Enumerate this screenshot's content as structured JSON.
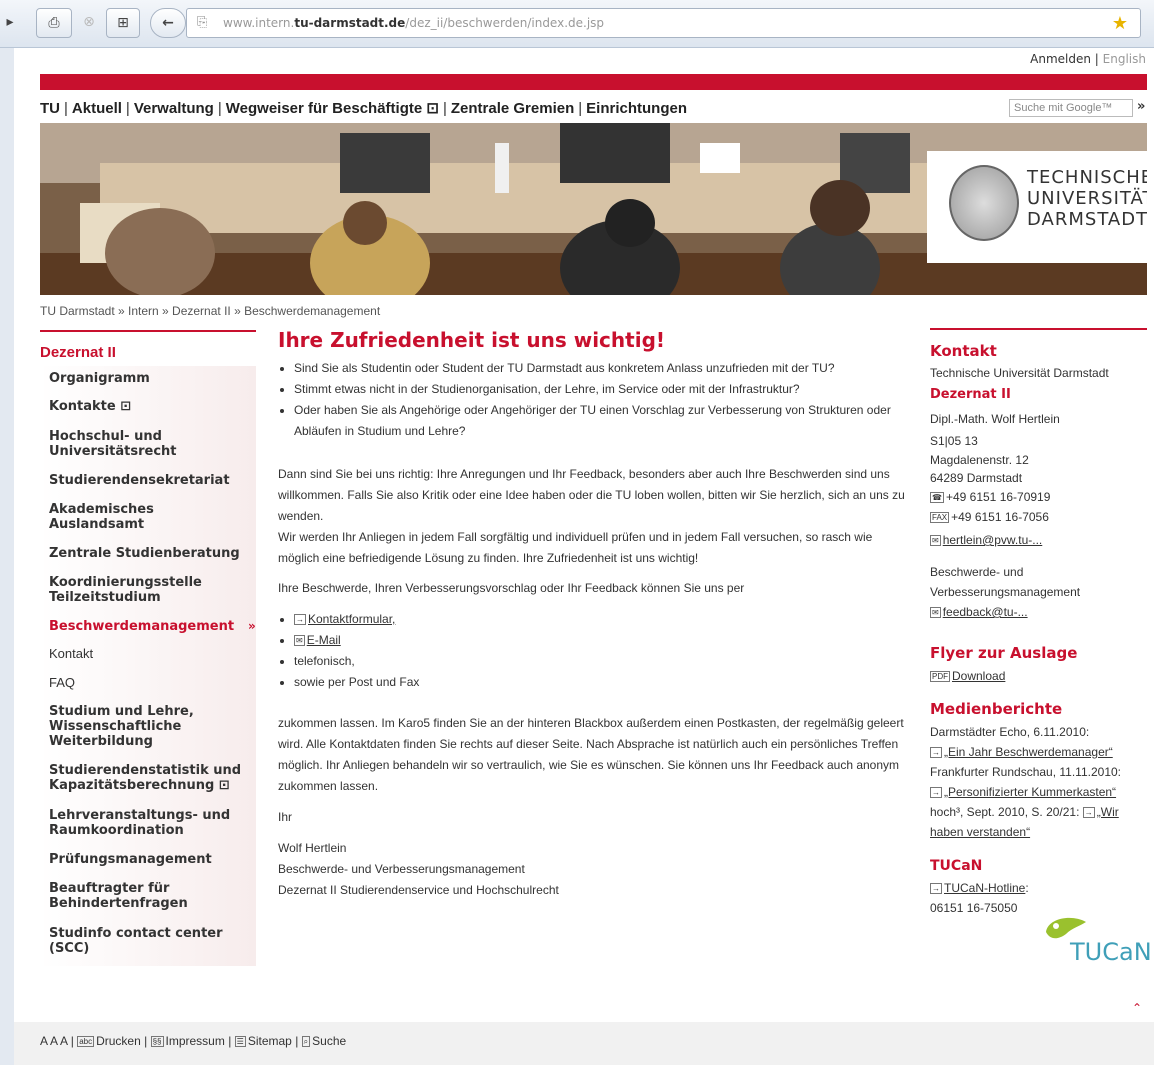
{
  "browser": {
    "url_prefix": "www.intern.",
    "url_domain": "tu-darmstadt.de",
    "url_path": "/dez_ii/beschwerden/index.de.jsp"
  },
  "top_links": {
    "login": "Anmelden",
    "separator": "|",
    "english": "English"
  },
  "main_nav": [
    {
      "label": "TU"
    },
    {
      "label": "Aktuell"
    },
    {
      "label": "Verwaltung"
    },
    {
      "label": "Wegweiser für Beschäftigte ⊡"
    },
    {
      "label": "Zentrale Gremien"
    },
    {
      "label": "Einrichtungen"
    }
  ],
  "search": {
    "placeholder": "Suche mit Google™",
    "go": "»"
  },
  "logo": {
    "line1": "TECHNISCHE",
    "line2": "UNIVERSITÄT",
    "line3": "DARMSTADT"
  },
  "breadcrumb": "TU Darmstadt » Intern » Dezernat II » Beschwerdemanagement",
  "left_nav": {
    "header": "Dezernat II",
    "items": [
      "Organigramm",
      "Kontakte ⊡",
      "Hochschul- und\nUniversitätsrecht",
      "Studierendensekretariat",
      "Akademisches\nAuslandsamt",
      "Zentrale Studienberatung",
      "Koordinierungsstelle\nTeilzeitstudium",
      "Beschwerdemanagement",
      "Kontakt",
      "FAQ",
      "Studium und Lehre,\nWissenschaftliche\nWeiterbildung",
      "Studierendenstatistik und\nKapazitätsberechnung ⊡",
      "Lehrveranstaltungs- und\nRaumkoordination",
      "Prüfungsmanagement",
      "Beauftragter für\nBehindertenfragen",
      "Studinfo contact center\n(SCC)"
    ],
    "active_marker": "»"
  },
  "main": {
    "title": "Ihre Zufriedenheit ist uns wichtig!",
    "bullets": [
      "Sind Sie als Studentin oder Student der TU Darmstadt aus konkretem Anlass unzufrieden mit der TU?",
      "Stimmt etwas nicht in der Studienorganisation, der Lehre, im Service oder mit der Infrastruktur?",
      "Oder haben Sie als Angehörige oder Angehöriger der TU einen Vorschlag zur Verbesserung von Strukturen oder Abläufen in Studium und Lehre?"
    ],
    "para1": "Dann sind Sie bei uns richtig: Ihre Anregungen und Ihr Feedback, besonders aber auch Ihre Beschwerden sind uns willkommen. Falls Sie also Kritik oder eine Idee haben oder die TU loben wollen, bitten wir Sie herzlich, sich an uns zu wenden.",
    "para2": "Wir werden Ihr Anliegen in jedem Fall sorgfältig und individuell prüfen und in jedem Fall versuchen, so rasch wie möglich eine befriedigende Lösung zu finden. Ihre Zufriedenheit ist uns wichtig!",
    "para3": "Ihre Beschwerde, Ihren Verbesserungsvorschlag oder Ihr Feedback können Sie uns per",
    "channels": {
      "form_icon": "→",
      "form": "Kontaktformular,",
      "mail_icon": "✉",
      "mail": "E-Mail",
      "phone": "telefonisch,",
      "post": "sowie per Post und Fax"
    },
    "para4": "zukommen lassen. Im Karo5 finden Sie an der hinteren Blackbox außerdem einen Postkasten, der regelmäßig geleert wird. Alle Kontaktdaten finden Sie rechts auf dieser Seite. Nach Absprache ist natürlich auch ein persönliches Treffen möglich. Ihr Anliegen behandeln wir so vertraulich, wie Sie es wünschen. Sie können uns Ihr Feedback auch anonym zukommen lassen.",
    "closing": "Ihr",
    "sig_name": "Wolf Hertlein",
    "sig_role": "Beschwerde- und Verbesserungsmanagement",
    "sig_dept": "Dezernat II Studierendenservice und Hochschulrecht"
  },
  "right": {
    "kontakt_header": "Kontakt",
    "university": "Technische Universität Darmstadt",
    "dept": "Dezernat II",
    "person": "Dipl.-Math. Wolf Hertlein",
    "room": "S1|05 13",
    "street": "Magdalenenstr. 12",
    "city": "64289 Darmstadt",
    "phone_icon": "☎",
    "phone": "+49 6151 16-70919",
    "fax_icon": "FAX",
    "fax": "+49 6151 16-7056",
    "email_icon": "✉",
    "email": "hertlein@pvw.tu-...",
    "mgmt": "Beschwerde- und Verbesserungsmanagement",
    "feedback_email": "feedback@tu-...",
    "flyer_header": "Flyer zur Auslage",
    "pdf_icon": "PDF",
    "flyer_link": "Download",
    "media_header": "Medienberichte",
    "media": [
      {
        "source": "Darmstädter Echo, 6.11.2010:",
        "link": "„Ein Jahr Beschwerdemanager“"
      },
      {
        "source": "Frankfurter Rundschau, 11.11.2010:",
        "link": "„Personifizierter Kummerkasten“"
      },
      {
        "source": "hoch³, Sept. 2010, S. 20/21:",
        "link": "„Wir haben verstanden“"
      }
    ],
    "tucan_header": "TUCaN",
    "tucan_link": "TUCaN-Hotline",
    "tucan_phone": ": 06151 16-75050",
    "tucan_logo": "TUCaN"
  },
  "footer": {
    "font_sizes": "A A A",
    "print_icon": "abc",
    "print": "Drucken",
    "imprint_icon": "§§",
    "imprint": "Impressum",
    "sitemap_icon": "☰",
    "sitemap": "Sitemap",
    "search_icon": "⌕",
    "search": "Suche",
    "sep": "|",
    "to_top": "⌃"
  }
}
